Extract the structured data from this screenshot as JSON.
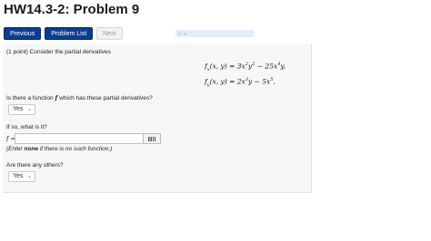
{
  "page": {
    "title": "HW14.3-2: Problem 9"
  },
  "nav": {
    "previous_label": "Previous",
    "problem_list_label": "Problem List",
    "next_label": "Next"
  },
  "problem": {
    "intro": "(1 point) Consider the partial derivatives",
    "fx": {
      "lhs_f": "f",
      "lhs_sub": "x",
      "lhs_args": "(x, y) = 3x",
      "e1": "2",
      "mid1": "y",
      "e2": "2",
      "mid2": " − 25x",
      "e3": "4",
      "tail": "y,"
    },
    "fy": {
      "lhs_f": "f",
      "lhs_sub": "y",
      "lhs_args": "(x, y) = 2x",
      "e1": "3",
      "mid1": "y − 5x",
      "e2": "5",
      "tail": "."
    },
    "q1": "Is there a function f which has these partial derivatives?",
    "q1_pre": "Is there a function ",
    "q1_f": "f",
    "q1_post": " which has these partial derivatives?",
    "q1_answer": "Yes",
    "q2": "If so, what is it?",
    "f_label": "f =",
    "f_value": "",
    "hint_pre": "(Enter ",
    "hint_bold": "none",
    "hint_post": " if there is no such function.)",
    "q3": "Are there any others?",
    "q3_answer": "Yes"
  }
}
